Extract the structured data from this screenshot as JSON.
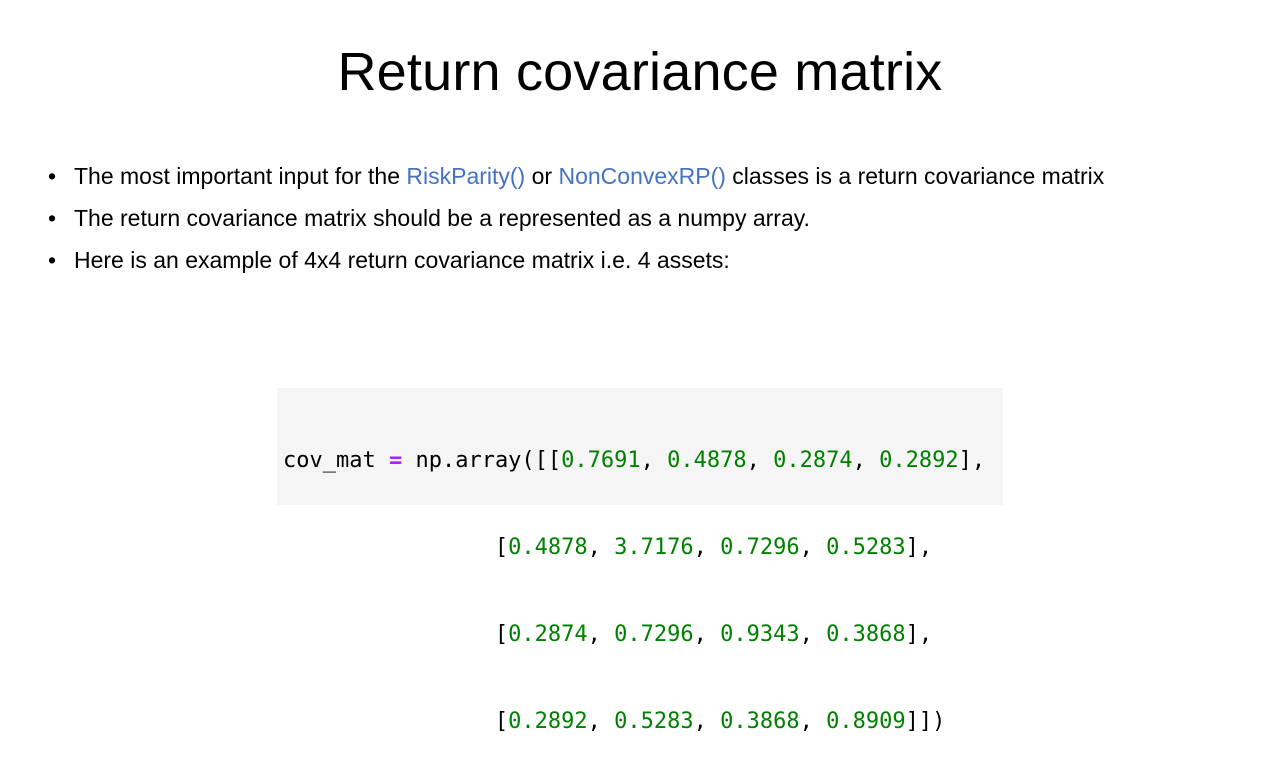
{
  "slide": {
    "title": "Return covariance matrix"
  },
  "bullets": [
    {
      "prefix": "The most important input for the ",
      "link1": "RiskParity()",
      "middle": " or ",
      "link2": "NonConvexRP()",
      "suffix": " classes is a return covariance matrix"
    },
    {
      "text": "The return covariance matrix should be a represented as a numpy array."
    },
    {
      "text": "Here is an example of 4x4 return covariance matrix i.e. 4 assets:"
    }
  ],
  "bullet_symbol": "•",
  "code": {
    "var_name": "cov_mat",
    "operator": "=",
    "call_open": "np.array([[",
    "indent": "                ",
    "row_open": "[",
    "separator": ", ",
    "row_close_mid": "],",
    "row_close_last": "]])",
    "first_row_close": "],",
    "matrix": [
      [
        "0.7691",
        "0.4878",
        "0.2874",
        "0.2892"
      ],
      [
        "0.4878",
        "3.7176",
        "0.7296",
        "0.5283"
      ],
      [
        "0.2874",
        "0.7296",
        "0.9343",
        "0.3868"
      ],
      [
        "0.2892",
        "0.5283",
        "0.3868",
        "0.8909"
      ]
    ]
  },
  "colors": {
    "link": "#4472c4",
    "code_number": "#008000",
    "code_operator": "#aa22ff",
    "code_background": "#f5f5f5"
  }
}
